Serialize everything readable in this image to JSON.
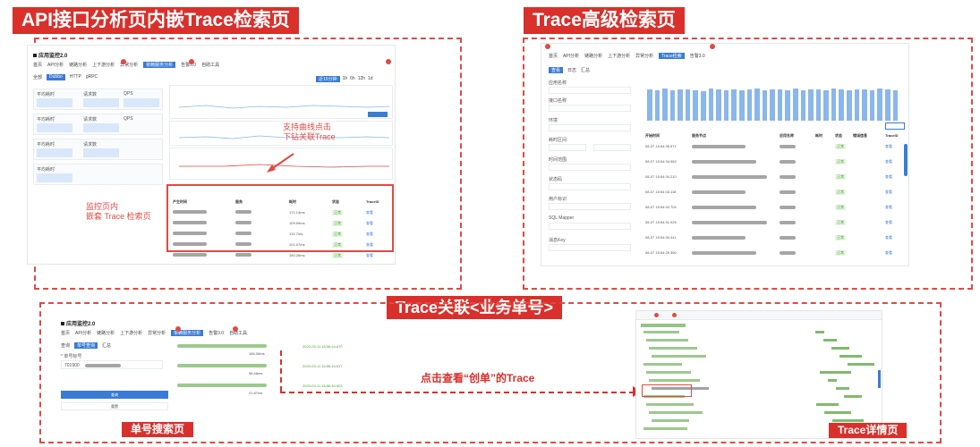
{
  "banners": {
    "top_left": "API接口分析页内嵌Trace检索页",
    "top_right": "Trace高级检索页",
    "middle": "Trace关联<业务单号>",
    "bottom_left": "单号搜索页",
    "bottom_right": "Trace详情页"
  },
  "annotations": {
    "curve_click": "支持曲线点击\n下钻关联Trace",
    "embedded": "监控页内\n嵌套 Trace 检索页",
    "view_trace": "点击查看“创单”的Trace"
  },
  "shot1": {
    "brand": "应用监控2.0",
    "nav": [
      "首页",
      "API分析",
      "链路分析",
      "上下游分析",
      "异常分析",
      "依赖服务分析",
      "告警3.0",
      "自助工具"
    ],
    "active_nav": "依赖服务分析",
    "tabs": [
      "全部",
      "Dubbo",
      "HTTP",
      "gRPC"
    ],
    "time_buttons": [
      "近15分钟",
      "1h",
      "6h",
      "12h",
      "1d",
      "最近时间"
    ],
    "metric_labels": [
      "平均耗时",
      "请求数",
      "QPS",
      "错误率"
    ],
    "table_headers": [
      "产生时间",
      "服务",
      "耗时",
      "状态",
      "TraceID"
    ],
    "durations": [
      "171.14ms",
      "109.59ms",
      "132.7ms",
      "101.07ms",
      "150.26ms"
    ],
    "status": "正常",
    "action_label": "查看"
  },
  "shot2": {
    "tabs": [
      "查看",
      "日志",
      "汇总"
    ],
    "filter_labels": [
      "应用名称",
      "接口名称",
      "环境",
      "耗时区间",
      "时间范围",
      "状态码",
      "用户标识",
      "SQL Mapper",
      "消息Key"
    ],
    "table_headers": [
      "开始时间",
      "服务节点",
      "应用名称",
      "耗时",
      "状态",
      "错误信息",
      "TraceID"
    ],
    "times": [
      "08-07 15:54:35.571",
      "08-07 15:54:34.982",
      "08-07 15:54:34.210",
      "08-07 15:54:33.118",
      "08-07 15:54:32.704",
      "08-07 15:54:31.926",
      "08-07 15:54:30.441",
      "08-07 15:54:29.350"
    ],
    "bar_values": [
      0.58,
      0.57,
      0.6,
      0.56,
      0.58,
      0.59,
      0.57,
      0.55,
      0.6,
      0.58,
      0.57,
      0.59,
      0.56,
      0.58,
      0.6,
      0.57,
      0.59,
      0.58,
      0.57,
      0.6,
      0.56,
      0.58,
      0.59,
      0.57,
      0.6,
      0.58,
      0.57,
      0.59,
      0.58,
      0.56,
      0.6,
      0.58,
      0.57
    ],
    "status": "正常",
    "action_label": "查看"
  },
  "shot3": {
    "brand": "应用监控2.0",
    "nav": [
      "首页",
      "API分析",
      "链路分析",
      "上下游分析",
      "异常分析",
      "依赖服务分析",
      "告警3.0",
      "自助工具"
    ],
    "tabs": [
      "查询",
      "单号查询",
      "汇总"
    ],
    "field_label": "* 单号标号",
    "field_value": "701900",
    "search_button": "查询",
    "reset_button": "重置",
    "timestamps": [
      "2023-03-11 16:56:44.670",
      "2023-03-11 16:56:44.617",
      "2023-03-11 16:56:44.603"
    ],
    "durations": [
      "166.06ms",
      "56.48ms",
      "21.87ms"
    ]
  },
  "shot4": {
    "header": "Trace详情"
  }
}
